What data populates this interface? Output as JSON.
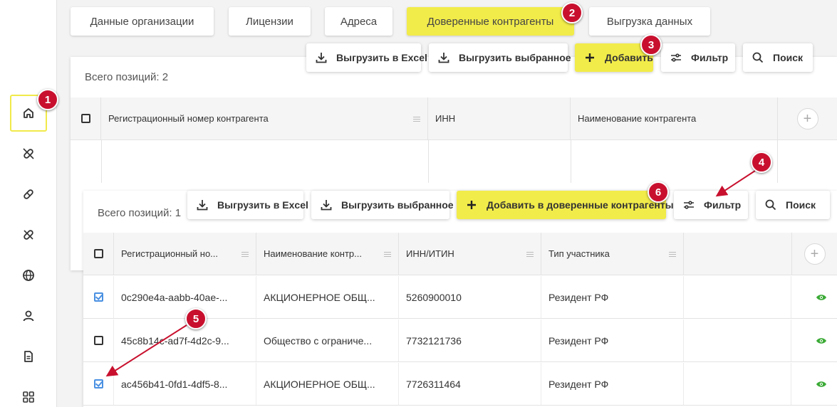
{
  "tabs": [
    {
      "label": "Данные организации"
    },
    {
      "label": "Лицензии"
    },
    {
      "label": "Адреса"
    },
    {
      "label": "Доверенные контрагенты"
    },
    {
      "label": "Выгрузка данных"
    }
  ],
  "sidebar": {
    "items": [
      {
        "icon": "home-icon"
      },
      {
        "icon": "pill-icon"
      },
      {
        "icon": "capsule-icon"
      },
      {
        "icon": "pill-blocked-icon"
      },
      {
        "icon": "globe-icon"
      },
      {
        "icon": "user-icon"
      },
      {
        "icon": "document-icon"
      },
      {
        "icon": "apps-icon"
      }
    ]
  },
  "back_panel": {
    "total": "Всего позиций: 2",
    "toolbar": {
      "export_excel": "Выгрузить в Excel",
      "export_selected": "Выгрузить выбранное",
      "add": "Добавить",
      "filter": "Фильтр",
      "search": "Поиск"
    },
    "columns": [
      "Регистрационный номер контрагента",
      "ИНН",
      "Наименование контрагента"
    ]
  },
  "front_panel": {
    "total": "Всего позиций: 1",
    "toolbar": {
      "export_excel": "Выгрузить в Excel",
      "export_selected": "Выгрузить выбранное",
      "add": "Добавить в доверенные контрагенты",
      "filter": "Фильтр",
      "search": "Поиск"
    },
    "columns": [
      "Регистрационный но...",
      "Наименование контр...",
      "ИНН/ИТИН",
      "Тип участника"
    ],
    "rows": [
      {
        "checked": true,
        "reg": "0c290e4a-aabb-40ae-...",
        "name": "АКЦИОНЕРНОЕ ОБЩ...",
        "inn": "5260900010",
        "type": "Резидент РФ"
      },
      {
        "checked": false,
        "reg": "45c8b14c-ad7f-4d2c-9...",
        "name": "Общество с ограниче...",
        "inn": "7732121736",
        "type": "Резидент РФ"
      },
      {
        "checked": true,
        "reg": "ac456b41-0fd1-4df5-8...",
        "name": "АКЦИОНЕРНОЕ ОБЩ...",
        "inn": "7726311464",
        "type": "Резидент РФ"
      }
    ]
  },
  "badges": [
    "1",
    "2",
    "3",
    "4",
    "5",
    "6"
  ],
  "colors": {
    "accent": "#f2ec4a",
    "badge": "#c8102e",
    "check": "#4a90e2",
    "eye": "#3aaa35"
  }
}
